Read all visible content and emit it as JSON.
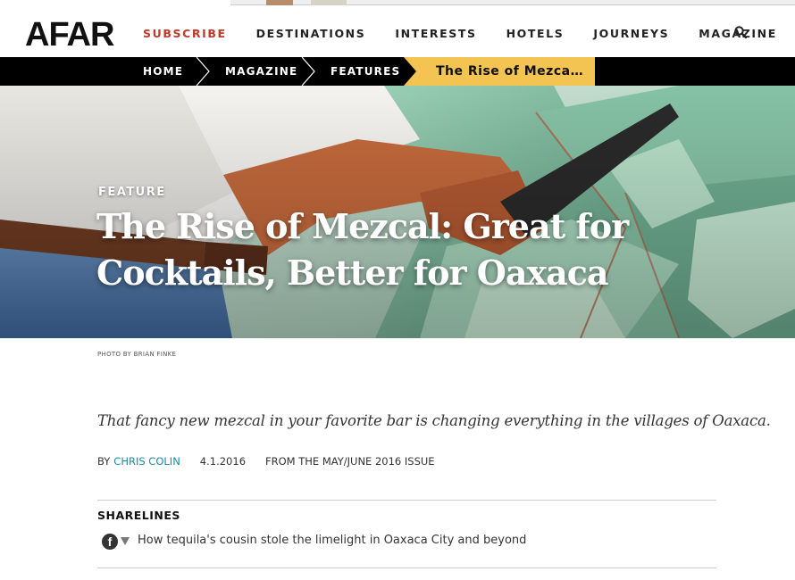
{
  "header": {
    "logo": "AFAR",
    "nav": [
      "SUBSCRIBE",
      "DESTINATIONS",
      "INTERESTS",
      "HOTELS",
      "JOURNEYS",
      "MAGAZINE"
    ],
    "search_icon": "search-icon"
  },
  "breadcrumb": {
    "items": [
      "HOME",
      "MAGAZINE",
      "FEATURES"
    ],
    "current": "The Rise of Mezca…"
  },
  "hero": {
    "kicker": "FEATURE",
    "title": "The Rise of Mezcal: Great for Cocktails, Better for Oaxaca"
  },
  "photo_credit": "PHOTO BY BRIAN FINKE",
  "dek": "That fancy new mezcal in your favorite bar is changing everything in the villages of Oaxaca.",
  "byline": {
    "prefix": "BY",
    "author": "CHRIS COLIN",
    "date": "4.1.2016",
    "issue": "FROM THE MAY/JUNE 2016 ISSUE"
  },
  "sharelines": {
    "title": "SHARELINES",
    "icon": "facebook-icon",
    "icon_glyph": "f",
    "items": [
      "How tequila's cousin stole the limelight in Oaxaca City and beyond"
    ]
  },
  "colors": {
    "subscribe": "#c0392b",
    "breadcrumb_bg": "#000000",
    "breadcrumb_current": "#f4c452",
    "author_link": "#1b8aa0",
    "agave_green": "#7fb59c"
  }
}
